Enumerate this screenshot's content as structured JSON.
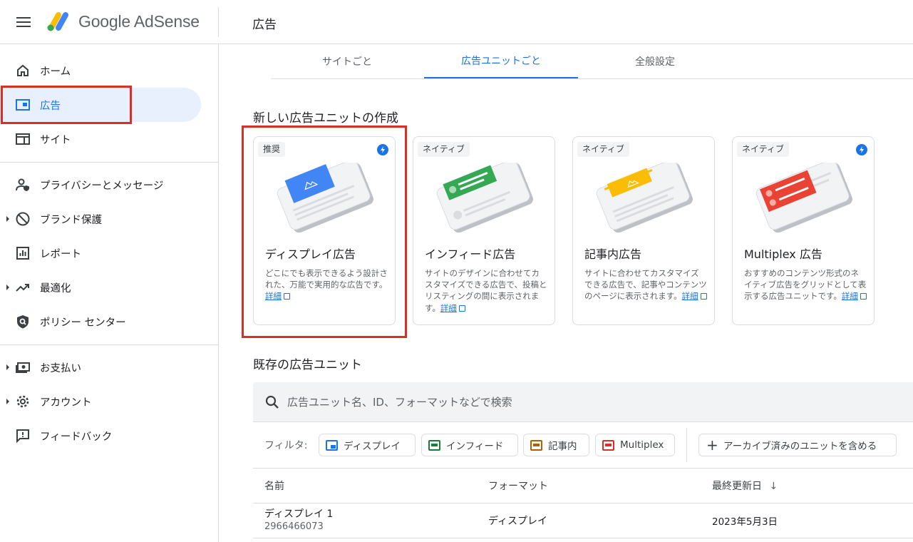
{
  "header": {
    "logo_text": "Google AdSense",
    "page_title": "広告"
  },
  "sidebar": {
    "items": [
      {
        "label": "ホーム"
      },
      {
        "label": "広告"
      },
      {
        "label": "サイト"
      },
      {
        "label": "プライバシーとメッセージ"
      },
      {
        "label": "ブランド保護"
      },
      {
        "label": "レポート"
      },
      {
        "label": "最適化"
      },
      {
        "label": "ポリシー センター"
      },
      {
        "label": "お支払い"
      },
      {
        "label": "アカウント"
      },
      {
        "label": "フィードバック"
      }
    ]
  },
  "tabs": [
    {
      "label": "サイトごと"
    },
    {
      "label": "広告ユニットごと"
    },
    {
      "label": "全般設定"
    }
  ],
  "create_section": {
    "title": "新しい広告ユニットの作成",
    "cards": [
      {
        "chip": "推奨",
        "title": "ディスプレイ広告",
        "desc": "どこにでも表示できるよう設計された、万能で実用的な広告です。",
        "link": "詳細",
        "accent": "#4285f4"
      },
      {
        "chip": "ネイティブ",
        "title": "インフィード広告",
        "desc": "サイトのデザインに合わせてカスタマイズできる広告で、投稿とリスティングの間に表示されます。",
        "link": "詳細",
        "accent": "#34a853"
      },
      {
        "chip": "ネイティブ",
        "title": "記事内広告",
        "desc": "サイトに合わせてカスタマイズできる広告で、記事やコンテンツのページに表示されます。",
        "link": "詳細",
        "accent": "#fbbc04"
      },
      {
        "chip": "ネイティブ",
        "title": "Multiplex 広告",
        "desc": "おすすめのコンテンツ形式のネイティブ広告をグリッドとして表示する広告ユニットです。",
        "link": "詳細",
        "accent": "#ea4335"
      }
    ]
  },
  "existing_section": {
    "title": "既存の広告ユニット",
    "search_placeholder": "広告ユニット名、ID、フォーマットなどで検索",
    "filter_label": "フィルタ:",
    "filters": [
      {
        "label": "ディスプレイ",
        "color": "#1a73e8"
      },
      {
        "label": "インフィード",
        "color": "#188038"
      },
      {
        "label": "記事内",
        "color": "#b06000"
      },
      {
        "label": "Multiplex",
        "color": "#d93025"
      }
    ],
    "archive_label": "アーカイブ済みのユニットを含める",
    "table": {
      "headers": [
        "名前",
        "フォーマット",
        "最終更新日"
      ],
      "sort_indicator": "↓",
      "rows": [
        {
          "name": "ディスプレイ 1",
          "id": "2966466073",
          "format": "ディスプレイ",
          "updated": "2023年5月3日"
        }
      ]
    }
  }
}
